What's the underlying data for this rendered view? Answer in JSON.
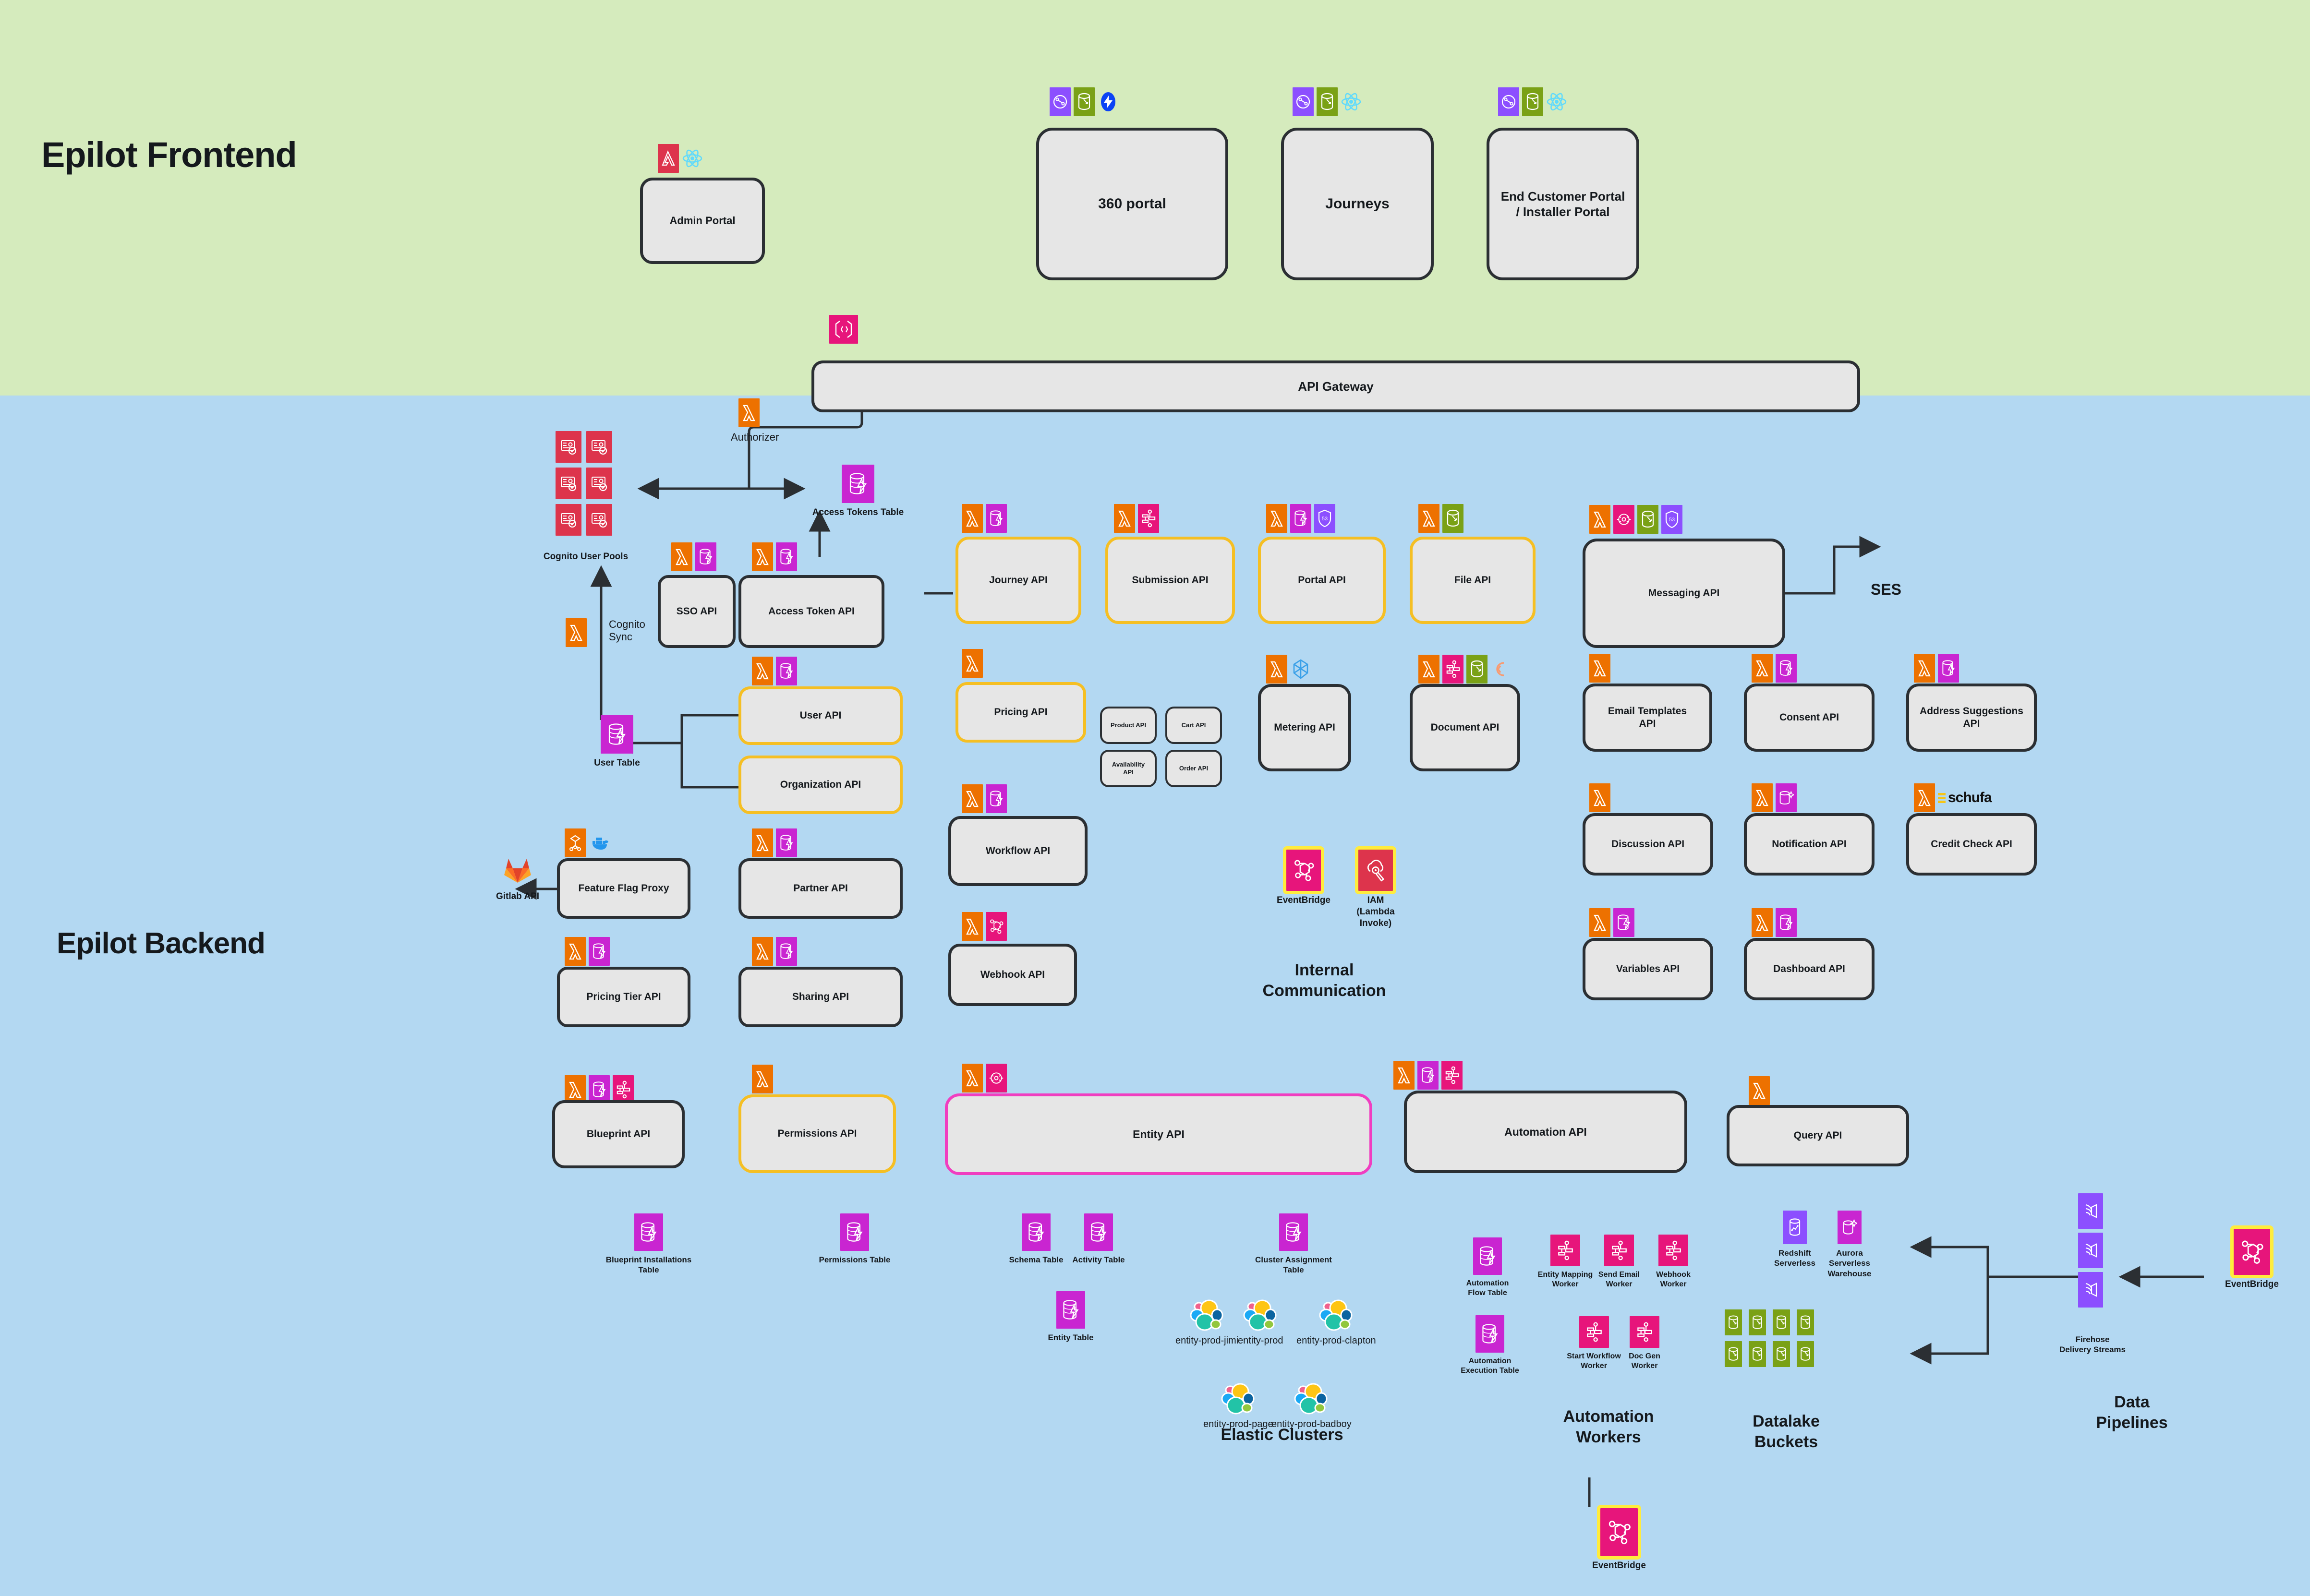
{
  "zones": {
    "frontend": {
      "title": "Epilot Frontend",
      "bg": "#d5ebbd"
    },
    "backend": {
      "title": "Epilot Backend",
      "bg": "#b3d8f2"
    }
  },
  "frontend": {
    "nodes": [
      {
        "label": "Admin Portal",
        "icons": [
          "amplify",
          "react"
        ]
      },
      {
        "label": "360 portal",
        "icons": [
          "cloudfront",
          "s3",
          "bolt"
        ]
      },
      {
        "label": "Journeys",
        "icons": [
          "cloudfront",
          "s3",
          "react"
        ]
      },
      {
        "label": "End Customer Portal\n/ Installer Portal",
        "icons": [
          "cloudfront",
          "s3",
          "react"
        ]
      }
    ]
  },
  "gateway": {
    "label": "API Gateway",
    "icon": "api-gateway"
  },
  "auth": {
    "authorizer_label": "Authorizer",
    "cognito_user_pools_label": "Cognito User Pools",
    "access_tokens_table_label": "Access Tokens Table",
    "cognito_sync_label": "Cognito\nSync",
    "user_table_label": "User Table"
  },
  "apis": [
    {
      "label": "SSO API",
      "icons": [
        "lambda",
        "dynamodb"
      ],
      "border": "dark"
    },
    {
      "label": "Access Token API",
      "icons": [
        "lambda",
        "dynamodb"
      ],
      "border": "dark"
    },
    {
      "label": "User API",
      "icons": [
        "lambda",
        "dynamodb"
      ],
      "border": "yellow"
    },
    {
      "label": "Organization API",
      "icons": [
        "lambda",
        "dynamodb"
      ],
      "border": "yellow"
    },
    {
      "label": "Feature Flag Proxy",
      "icons": [
        "ecs",
        "docker"
      ],
      "border": "dark"
    },
    {
      "label": "Pricing Tier API",
      "icons": [
        "lambda",
        "dynamodb"
      ],
      "border": "dark"
    },
    {
      "label": "Partner API",
      "icons": [
        "lambda",
        "dynamodb"
      ],
      "border": "dark"
    },
    {
      "label": "Sharing API",
      "icons": [
        "lambda",
        "dynamodb"
      ],
      "border": "dark"
    },
    {
      "label": "Journey API",
      "icons": [
        "lambda",
        "dynamodb"
      ],
      "border": "yellow"
    },
    {
      "label": "Submission API",
      "icons": [
        "lambda",
        "step-functions"
      ],
      "border": "yellow"
    },
    {
      "label": "Portal API",
      "icons": [
        "lambda",
        "dynamodb",
        "route53"
      ],
      "border": "yellow"
    },
    {
      "label": "File API",
      "icons": [
        "lambda",
        "s3"
      ],
      "border": "yellow"
    },
    {
      "label": "Pricing API",
      "icons": [
        "lambda"
      ],
      "border": "yellow"
    },
    {
      "label": "Metering API",
      "icons": [
        "lambda",
        "timestream"
      ],
      "border": "dark"
    },
    {
      "label": "Document API",
      "icons": [
        "lambda",
        "step-functions",
        "s3",
        "appflow"
      ],
      "border": "dark"
    },
    {
      "label": "Workflow API",
      "icons": [
        "lambda",
        "dynamodb"
      ],
      "border": "dark"
    },
    {
      "label": "Webhook API",
      "icons": [
        "lambda",
        "eventbridge"
      ],
      "border": "dark"
    },
    {
      "label": "Messaging API",
      "icons": [
        "lambda",
        "eventbridge",
        "s3",
        "route53"
      ],
      "border": "dark"
    },
    {
      "label": "Email Templates\nAPI",
      "icons": [
        "lambda"
      ],
      "border": "dark"
    },
    {
      "label": "Consent API",
      "icons": [
        "lambda",
        "dynamodb"
      ],
      "border": "dark"
    },
    {
      "label": "Address Suggestions API",
      "icons": [
        "lambda",
        "dynamodb"
      ],
      "border": "dark"
    },
    {
      "label": "Discussion API",
      "icons": [
        "lambda"
      ],
      "border": "dark"
    },
    {
      "label": "Notification API",
      "icons": [
        "lambda",
        "dynamodb-sparkle"
      ],
      "border": "dark"
    },
    {
      "label": "Credit Check API",
      "icons": [
        "lambda",
        "schufa"
      ],
      "border": "dark"
    },
    {
      "label": "Variables API",
      "icons": [
        "lambda",
        "dynamodb"
      ],
      "border": "dark"
    },
    {
      "label": "Dashboard API",
      "icons": [
        "lambda",
        "dynamodb"
      ],
      "border": "dark"
    },
    {
      "label": "Blueprint API",
      "icons": [
        "lambda",
        "dynamodb",
        "step-functions"
      ],
      "border": "dark"
    },
    {
      "label": "Permissions API",
      "icons": [
        "lambda"
      ],
      "border": "yellow"
    },
    {
      "label": "Entity API",
      "icons": [
        "lambda",
        "eventbridge"
      ],
      "border": "magenta"
    },
    {
      "label": "Automation API",
      "icons": [
        "lambda",
        "dynamodb",
        "step-functions"
      ],
      "border": "dark"
    },
    {
      "label": "Query API",
      "icons": [
        "lambda"
      ],
      "border": "dark"
    }
  ],
  "pricing_subapis": [
    {
      "label": "Product API"
    },
    {
      "label": "Cart API"
    },
    {
      "label": "Availability API"
    },
    {
      "label": "Order API"
    }
  ],
  "tables": [
    {
      "label": "Blueprint Installations\nTable"
    },
    {
      "label": "Permissions Table"
    },
    {
      "label": "Schema Table"
    },
    {
      "label": "Activity Table"
    },
    {
      "label": "Entity Table"
    },
    {
      "label": "Cluster Assignment\nTable"
    },
    {
      "label": "Automation\nFlow Table"
    },
    {
      "label": "Automation\nExecution Table"
    }
  ],
  "internal_communication": {
    "group_label": "Internal\nCommunication",
    "items": [
      {
        "label": "EventBridge",
        "icon": "eventbridge",
        "highlight": true
      },
      {
        "label": "IAM\n(Lambda\nInvoke)",
        "icon": "iam",
        "highlight": true
      }
    ]
  },
  "elastic_clusters": {
    "group_label": "Elastic Clusters",
    "items": [
      {
        "label": "entity-prod-jimi"
      },
      {
        "label": "entity-prod"
      },
      {
        "label": "entity-prod-clapton"
      },
      {
        "label": "entity-prod-page"
      },
      {
        "label": "entity-prod-badboy"
      }
    ]
  },
  "automation_workers": {
    "group_label": "Automation\nWorkers",
    "items": [
      {
        "label": "Entity Mapping\nWorker"
      },
      {
        "label": "Send Email\nWorker"
      },
      {
        "label": "Webhook\nWorker"
      },
      {
        "label": "Start Workflow\nWorker"
      },
      {
        "label": "Doc Gen\nWorker"
      }
    ]
  },
  "datalake": {
    "group_label": "Datalake\nBuckets",
    "redshift_label": "Redshift\nServerless",
    "aurora_label": "Aurora\nServerless\nWarehouse",
    "bucket_count": 8
  },
  "data_pipelines": {
    "group_label": "Data\nPipelines",
    "firehose_label": "Firehose\nDelivery Streams",
    "eventbridge_label": "EventBridge",
    "firehose_count": 3
  },
  "bottom_eventbridge": {
    "label": "EventBridge"
  },
  "external": {
    "ses_label": "SES",
    "gitlab_label": "Gitlab API"
  },
  "colors": {
    "lambda": "#ed7100",
    "dynamodb": "#c925d1",
    "step_functions": "#e7157b",
    "eventbridge": "#e7157b",
    "s3": "#7aa116",
    "cloudfront": "#8c4fff",
    "cognito": "#dd344c",
    "highlight_yellow": "#ffec3d",
    "border_yellow": "#f5bf24",
    "border_magenta": "#f03ec0",
    "frontend_bg": "#d5ebbd",
    "backend_bg": "#b3d8f2",
    "node_fill": "#e6e6e6",
    "node_stroke": "#2b2f33"
  }
}
